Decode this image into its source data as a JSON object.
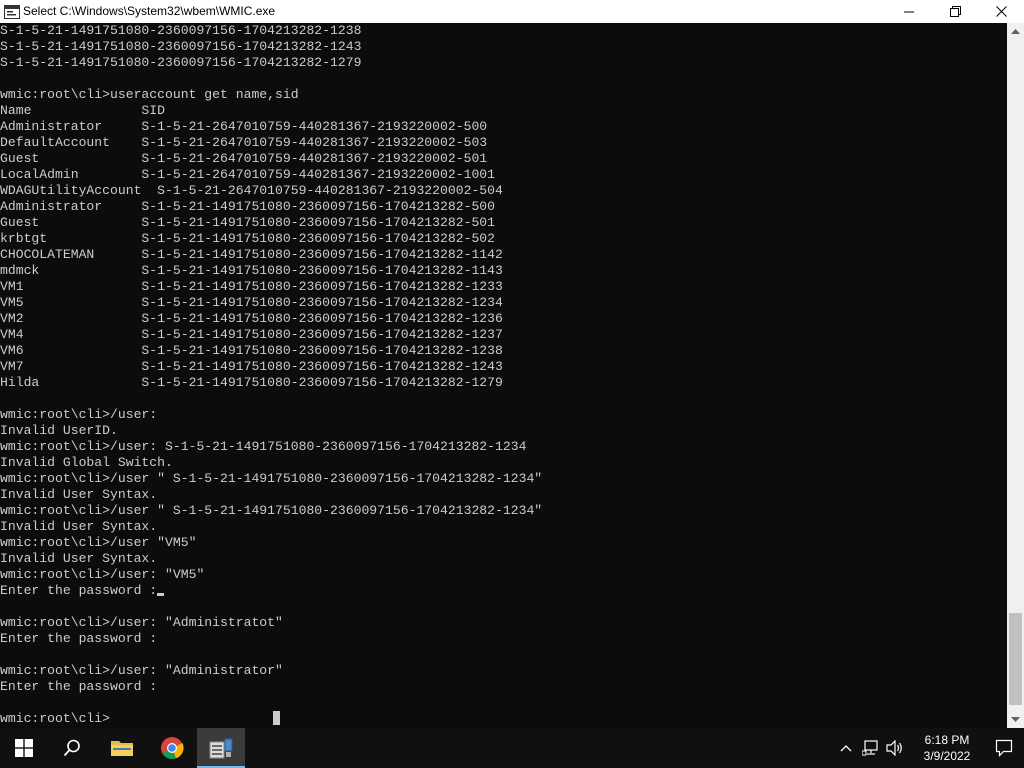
{
  "window": {
    "title": "Select C:\\Windows\\System32\\wbem\\WMIC.exe",
    "minimize_glyph": "─",
    "maximize_glyph": "❐",
    "close_glyph": "✕"
  },
  "console": {
    "lines": [
      "S-1-5-21-1491751080-2360097156-1704213282-1238",
      "S-1-5-21-1491751080-2360097156-1704213282-1243",
      "S-1-5-21-1491751080-2360097156-1704213282-1279",
      "",
      "wmic:root\\cli>useraccount get name,sid",
      "Name              SID",
      "Administrator     S-1-5-21-2647010759-440281367-2193220002-500",
      "DefaultAccount    S-1-5-21-2647010759-440281367-2193220002-503",
      "Guest             S-1-5-21-2647010759-440281367-2193220002-501",
      "LocalAdmin        S-1-5-21-2647010759-440281367-2193220002-1001",
      "WDAGUtilityAccount  S-1-5-21-2647010759-440281367-2193220002-504",
      "Administrator     S-1-5-21-1491751080-2360097156-1704213282-500",
      "Guest             S-1-5-21-1491751080-2360097156-1704213282-501",
      "krbtgt            S-1-5-21-1491751080-2360097156-1704213282-502",
      "CHOCOLATEMAN      S-1-5-21-1491751080-2360097156-1704213282-1142",
      "mdmck             S-1-5-21-1491751080-2360097156-1704213282-1143",
      "VM1               S-1-5-21-1491751080-2360097156-1704213282-1233",
      "VM5               S-1-5-21-1491751080-2360097156-1704213282-1234",
      "VM2               S-1-5-21-1491751080-2360097156-1704213282-1236",
      "VM4               S-1-5-21-1491751080-2360097156-1704213282-1237",
      "VM6               S-1-5-21-1491751080-2360097156-1704213282-1238",
      "VM7               S-1-5-21-1491751080-2360097156-1704213282-1243",
      "Hilda             S-1-5-21-1491751080-2360097156-1704213282-1279",
      "",
      "wmic:root\\cli>/user:",
      "Invalid UserID.",
      "wmic:root\\cli>/user: S-1-5-21-1491751080-2360097156-1704213282-1234",
      "Invalid Global Switch.",
      "wmic:root\\cli>/user \" S-1-5-21-1491751080-2360097156-1704213282-1234\"",
      "Invalid User Syntax.",
      "wmic:root\\cli>/user \" S-1-5-21-1491751080-2360097156-1704213282-1234\"",
      "Invalid User Syntax.",
      "wmic:root\\cli>/user \"VM5\"",
      "Invalid User Syntax.",
      "wmic:root\\cli>/user: \"VM5\"",
      "Enter the password :",
      "",
      "wmic:root\\cli>/user: \"Administratot\"",
      "Enter the password :",
      "",
      "wmic:root\\cli>/user: \"Administrator\"",
      "Enter the password :",
      "",
      "wmic:root\\cli>"
    ]
  },
  "taskbar": {
    "apps": [
      {
        "name": "start-button",
        "icon": "windows-logo-icon",
        "active": false
      },
      {
        "name": "search-button",
        "icon": "search-icon",
        "active": false
      },
      {
        "name": "file-explorer-button",
        "icon": "folder-icon",
        "active": false
      },
      {
        "name": "chrome-button",
        "icon": "chrome-icon",
        "active": false
      },
      {
        "name": "wmic-button",
        "icon": "wmic-icon",
        "active": true
      }
    ],
    "time": "6:18 PM",
    "date": "3/9/2022"
  },
  "colors": {
    "console_bg": "#0c0c0c",
    "console_fg": "#cccccc",
    "taskbar_bg": "#101010",
    "active_indicator": "#76b9ed"
  }
}
